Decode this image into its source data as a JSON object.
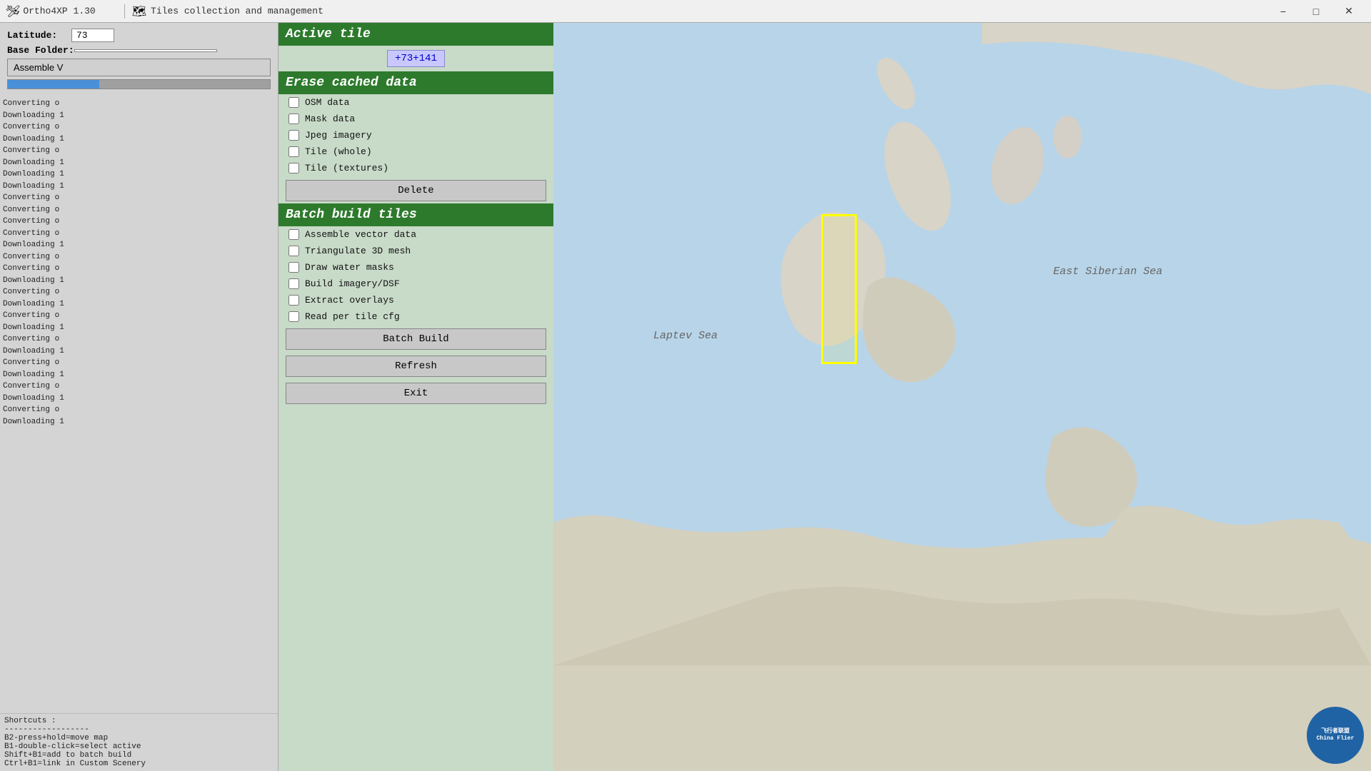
{
  "titlebar": {
    "app_title": "Ortho4XP 1.30",
    "tile_title": "Tiles collection and management",
    "min_label": "−",
    "max_label": "□",
    "close_label": "✕"
  },
  "top_controls": {
    "latitude_label": "Latitude:",
    "latitude_value": "73",
    "base_folder_label": "Base Folder:",
    "base_folder_value": "",
    "assemble_label": "Assemble V",
    "progress_pct": 35
  },
  "tiles_panel": {
    "active_tile_header": "Active tile",
    "active_tile_value": "+73+141",
    "erase_header": "Erase cached data",
    "erase_checkboxes": [
      {
        "id": "osm",
        "label": "OSM data",
        "checked": false
      },
      {
        "id": "mask",
        "label": "Mask data",
        "checked": false
      },
      {
        "id": "jpeg",
        "label": "Jpeg imagery",
        "checked": false
      },
      {
        "id": "tile_whole",
        "label": "Tile (whole)",
        "checked": false
      },
      {
        "id": "tile_tex",
        "label": "Tile (textures)",
        "checked": false
      }
    ],
    "delete_label": "Delete",
    "batch_header": "Batch build tiles",
    "batch_checkboxes": [
      {
        "id": "assemble_vec",
        "label": "Assemble vector data",
        "checked": false
      },
      {
        "id": "triangulate",
        "label": "Triangulate 3D mesh",
        "checked": false
      },
      {
        "id": "draw_water",
        "label": "Draw water masks",
        "checked": false
      },
      {
        "id": "build_imagery",
        "label": "Build imagery/DSF",
        "checked": false
      },
      {
        "id": "extract_overlays",
        "label": "Extract overlays",
        "checked": false
      },
      {
        "id": "read_cfg",
        "label": "Read per tile cfg",
        "checked": false
      }
    ],
    "batch_build_label": "Batch Build",
    "refresh_label": "Refresh",
    "exit_label": "Exit"
  },
  "shortcuts": {
    "title": "Shortcuts :",
    "lines": [
      "------------------",
      "B2-press+hold=move map",
      "B1-double-click=select active",
      "Shift+B1=add to batch build",
      "Ctrl+B1=link in Custom Scenery"
    ]
  },
  "log": {
    "lines": [
      "Converting o",
      "Downloading 1",
      "Converting o",
      "Downloading 1",
      "Converting o",
      "Downloading 1",
      "Downloading 1",
      "Downloading 1",
      "Converting o",
      "Converting o",
      "Converting o",
      "Converting o",
      "Downloading 1",
      "Converting o",
      "Converting o",
      "Downloading 1",
      "Converting o",
      "Downloading 1",
      "Converting o",
      "Downloading 1",
      "Converting o",
      "Downloading 1",
      "Converting o",
      "Downloading 1",
      "Converting o",
      "Downloading 1",
      "Converting o",
      "Downloading 1"
    ]
  },
  "map": {
    "sea_label_1": "Laptev Sea",
    "sea_label_2": "East Siberian Sea",
    "tile_box": {
      "top": "270",
      "left": "380",
      "width": "50",
      "height": "210"
    }
  }
}
